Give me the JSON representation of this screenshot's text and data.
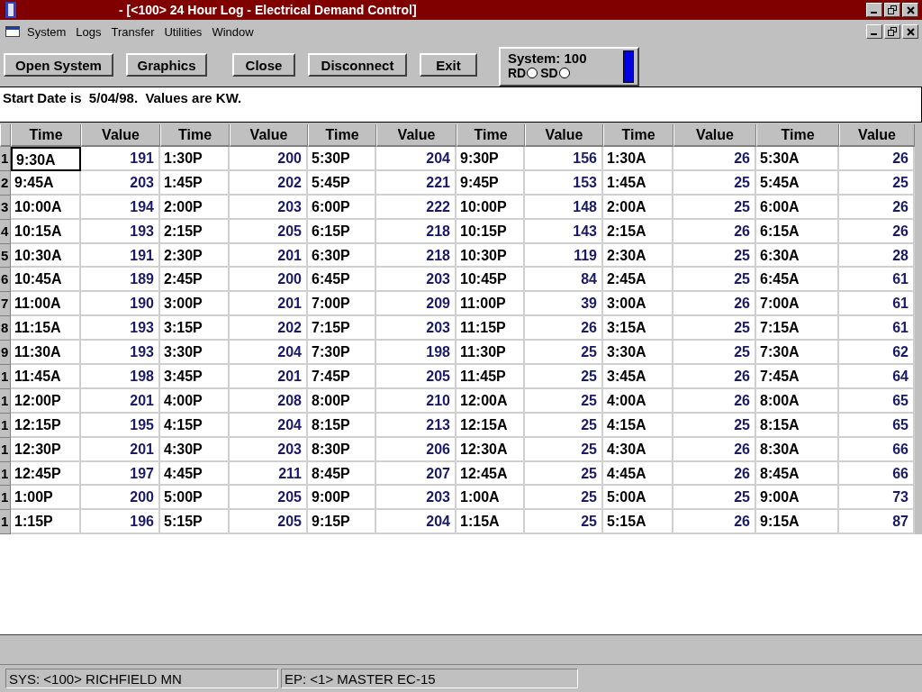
{
  "window": {
    "title": "- [<100> 24 Hour Log - Electrical Demand Control]"
  },
  "menu": [
    "System",
    "Logs",
    "Transfer",
    "Utilities",
    "Window"
  ],
  "toolbar": {
    "buttons": [
      "Open System",
      "Graphics",
      "Close",
      "Disconnect",
      "Exit"
    ],
    "system_panel": {
      "label": "System: 100",
      "indicators": [
        {
          "label": "RD",
          "on": false
        },
        {
          "label": "SD",
          "on": false
        }
      ]
    }
  },
  "info": "Start Date is  5/04/98.  Values are KW.",
  "table": {
    "columns": [
      {
        "label": "Time",
        "kind": "time"
      },
      {
        "label": "Value",
        "kind": "value"
      },
      {
        "label": "Time",
        "kind": "time"
      },
      {
        "label": "Value",
        "kind": "value"
      },
      {
        "label": "Time",
        "kind": "time"
      },
      {
        "label": "Value",
        "kind": "value"
      },
      {
        "label": "Time",
        "kind": "time"
      },
      {
        "label": "Value",
        "kind": "value"
      },
      {
        "label": "Time",
        "kind": "time"
      },
      {
        "label": "Value",
        "kind": "value"
      },
      {
        "label": "Time",
        "kind": "time"
      },
      {
        "label": "Value",
        "kind": "value"
      }
    ],
    "rows": [
      {
        "header": "1",
        "focused": true,
        "cells": [
          "9:30A",
          "191",
          "1:30P",
          "200",
          "5:30P",
          "204",
          "9:30P",
          "156",
          "1:30A",
          "26",
          "5:30A",
          "26"
        ]
      },
      {
        "header": "2",
        "focused": false,
        "cells": [
          "9:45A",
          "203",
          "1:45P",
          "202",
          "5:45P",
          "221",
          "9:45P",
          "153",
          "1:45A",
          "25",
          "5:45A",
          "25"
        ]
      },
      {
        "header": "3",
        "focused": false,
        "cells": [
          "10:00A",
          "194",
          "2:00P",
          "203",
          "6:00P",
          "222",
          "10:00P",
          "148",
          "2:00A",
          "25",
          "6:00A",
          "26"
        ]
      },
      {
        "header": "4",
        "focused": false,
        "cells": [
          "10:15A",
          "193",
          "2:15P",
          "205",
          "6:15P",
          "218",
          "10:15P",
          "143",
          "2:15A",
          "26",
          "6:15A",
          "26"
        ]
      },
      {
        "header": "5",
        "focused": false,
        "cells": [
          "10:30A",
          "191",
          "2:30P",
          "201",
          "6:30P",
          "218",
          "10:30P",
          "119",
          "2:30A",
          "25",
          "6:30A",
          "28"
        ]
      },
      {
        "header": "6",
        "focused": false,
        "cells": [
          "10:45A",
          "189",
          "2:45P",
          "200",
          "6:45P",
          "203",
          "10:45P",
          "84",
          "2:45A",
          "25",
          "6:45A",
          "61"
        ]
      },
      {
        "header": "7",
        "focused": false,
        "cells": [
          "11:00A",
          "190",
          "3:00P",
          "201",
          "7:00P",
          "209",
          "11:00P",
          "39",
          "3:00A",
          "26",
          "7:00A",
          "61"
        ]
      },
      {
        "header": "8",
        "focused": false,
        "cells": [
          "11:15A",
          "193",
          "3:15P",
          "202",
          "7:15P",
          "203",
          "11:15P",
          "26",
          "3:15A",
          "25",
          "7:15A",
          "61"
        ]
      },
      {
        "header": "9",
        "focused": false,
        "cells": [
          "11:30A",
          "193",
          "3:30P",
          "204",
          "7:30P",
          "198",
          "11:30P",
          "25",
          "3:30A",
          "25",
          "7:30A",
          "62"
        ]
      },
      {
        "header": "1",
        "focused": false,
        "cells": [
          "11:45A",
          "198",
          "3:45P",
          "201",
          "7:45P",
          "205",
          "11:45P",
          "25",
          "3:45A",
          "26",
          "7:45A",
          "64"
        ]
      },
      {
        "header": "1",
        "focused": false,
        "cells": [
          "12:00P",
          "201",
          "4:00P",
          "208",
          "8:00P",
          "210",
          "12:00A",
          "25",
          "4:00A",
          "26",
          "8:00A",
          "65"
        ]
      },
      {
        "header": "1",
        "focused": false,
        "cells": [
          "12:15P",
          "195",
          "4:15P",
          "204",
          "8:15P",
          "213",
          "12:15A",
          "25",
          "4:15A",
          "25",
          "8:15A",
          "65"
        ]
      },
      {
        "header": "1",
        "focused": false,
        "cells": [
          "12:30P",
          "201",
          "4:30P",
          "203",
          "8:30P",
          "206",
          "12:30A",
          "25",
          "4:30A",
          "26",
          "8:30A",
          "66"
        ]
      },
      {
        "header": "1",
        "focused": false,
        "cells": [
          "12:45P",
          "197",
          "4:45P",
          "211",
          "8:45P",
          "207",
          "12:45A",
          "25",
          "4:45A",
          "26",
          "8:45A",
          "66"
        ]
      },
      {
        "header": "1",
        "focused": false,
        "cells": [
          "1:00P",
          "200",
          "5:00P",
          "205",
          "9:00P",
          "203",
          "1:00A",
          "25",
          "5:00A",
          "25",
          "9:00A",
          "73"
        ]
      },
      {
        "header": "1",
        "focused": false,
        "cells": [
          "1:15P",
          "196",
          "5:15P",
          "205",
          "9:15P",
          "204",
          "1:15A",
          "25",
          "5:15A",
          "26",
          "9:15A",
          "87"
        ]
      }
    ]
  },
  "status_bar": [
    "SYS: <100> RICHFIELD MN",
    "EP: <1> MASTER EC-15"
  ]
}
